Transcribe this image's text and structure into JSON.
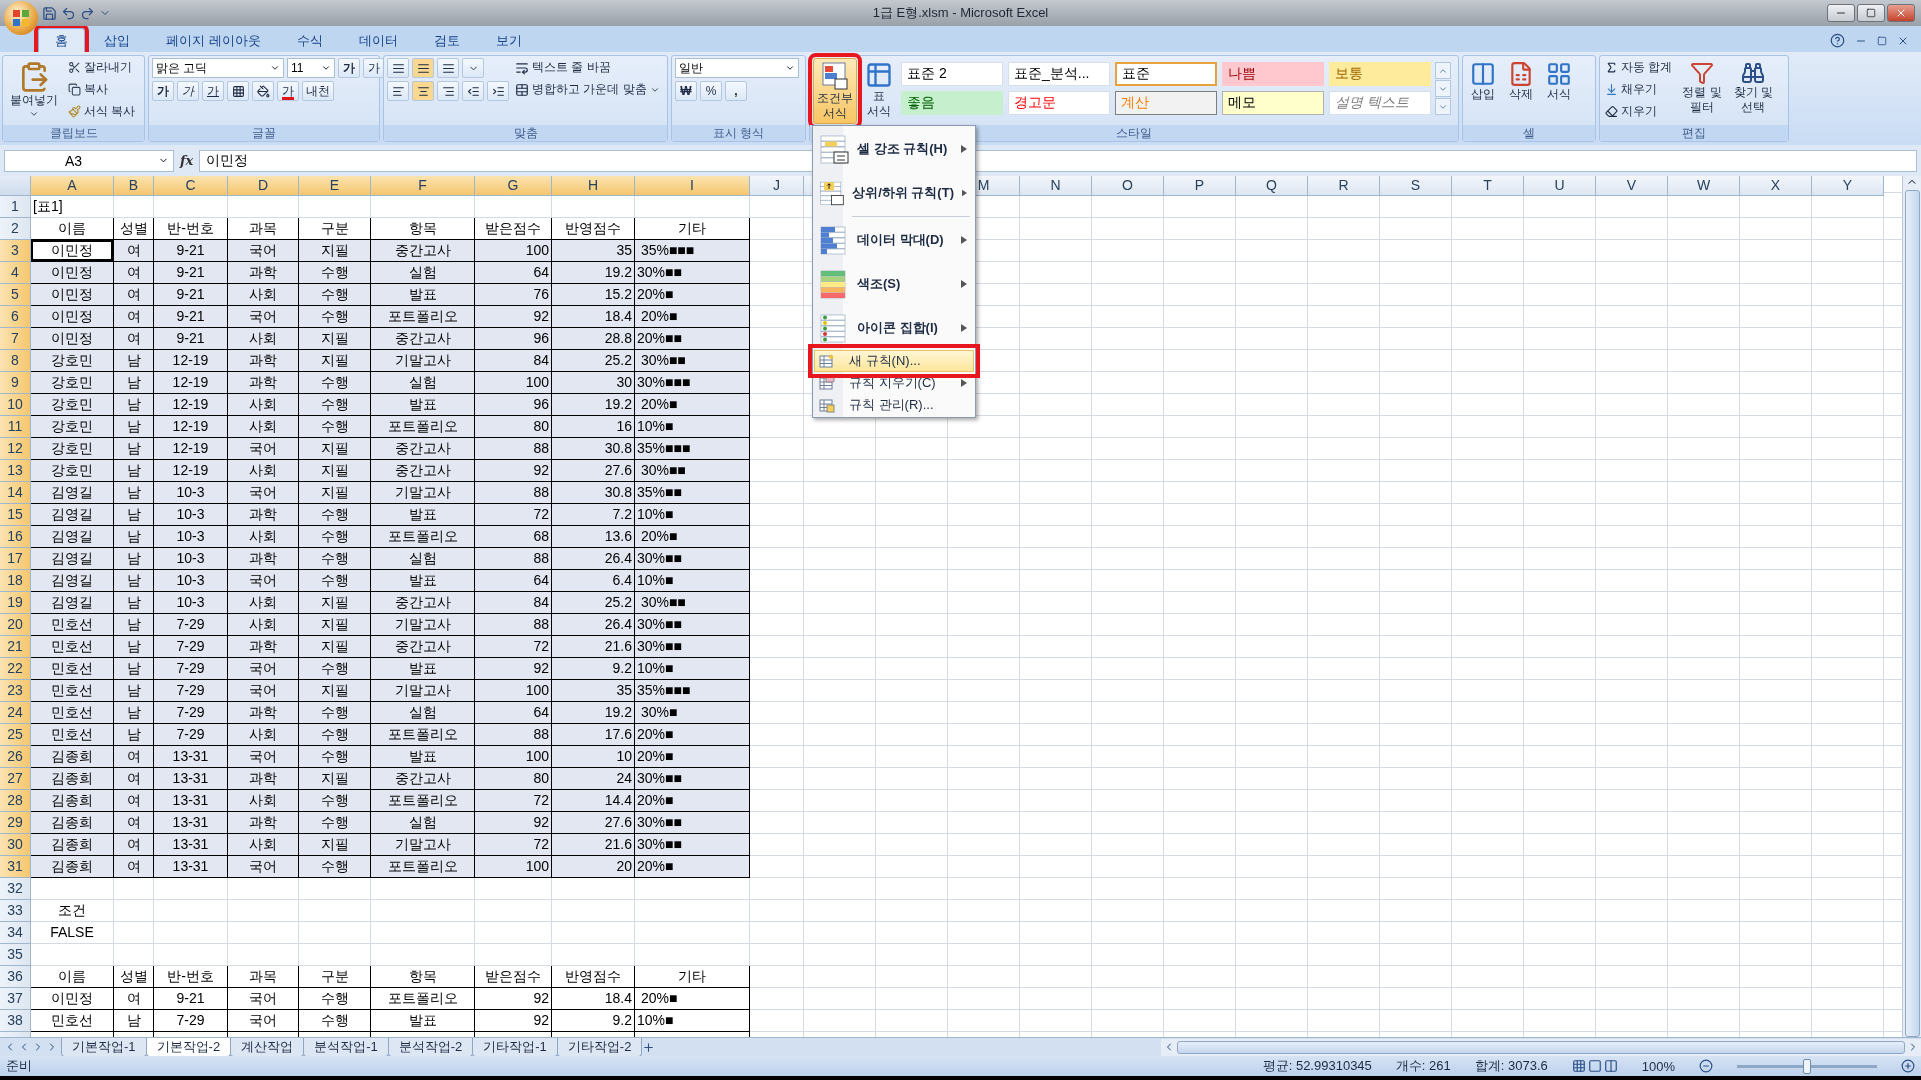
{
  "window": {
    "title": "1급 E형.xlsm - Microsoft Excel"
  },
  "ribbon": {
    "tabs": [
      {
        "label": "홈",
        "selected": true,
        "annotated": true
      },
      {
        "label": "삽입",
        "selected": false
      },
      {
        "label": "페이지 레이아웃",
        "selected": false
      },
      {
        "label": "수식",
        "selected": false
      },
      {
        "label": "데이터",
        "selected": false
      },
      {
        "label": "검토",
        "selected": false
      },
      {
        "label": "보기",
        "selected": false
      }
    ],
    "clipboard": {
      "paste": "붙여넣기",
      "cut": "잘라내기",
      "copy": "복사",
      "format_painter": "서식 복사",
      "label": "클립보드"
    },
    "font": {
      "name": "맑은 고딕",
      "size": "11",
      "grow": "가",
      "shrink": "가",
      "bold": "가",
      "italic": "가",
      "underline": "가",
      "font_color": "가",
      "phonetic": "내천",
      "label": "글꼴"
    },
    "alignment": {
      "wrap": "텍스트 줄 바꿈",
      "merge": "병합하고 가운데 맞춤",
      "label": "맞춤"
    },
    "number": {
      "format": "일반",
      "currency": "₩",
      "percent": "%",
      "comma": ",",
      "label": "표시 형식"
    },
    "styles": {
      "conditional": {
        "lines": [
          "조건부",
          "서식"
        ],
        "annotated": true
      },
      "table_format": {
        "lines": [
          "표",
          "서식"
        ]
      },
      "gallery": [
        {
          "label": "표준 2",
          "kind": "normal",
          "selected": false
        },
        {
          "label": "표준_분석...",
          "kind": "normal",
          "selected": false
        },
        {
          "label": "표준",
          "kind": "normal",
          "selected": true
        },
        {
          "label": "나쁨",
          "kind": "bad",
          "selected": false
        },
        {
          "label": "보통",
          "kind": "neutral",
          "selected": false
        },
        {
          "label": "좋음",
          "kind": "good",
          "selected": false
        },
        {
          "label": "경고문",
          "kind": "warning",
          "selected": false
        },
        {
          "label": "계산",
          "kind": "calc",
          "selected": false
        },
        {
          "label": "메모",
          "kind": "note",
          "selected": false
        },
        {
          "label": "설명 텍스트",
          "kind": "explanatory",
          "selected": false
        }
      ],
      "label": "스타일"
    },
    "cells": {
      "insert": "삽입",
      "delete": "삭제",
      "format": "서식",
      "label": "셀"
    },
    "editing": {
      "autosum": "자동 합계",
      "fill": "채우기",
      "clear": "지우기",
      "sort": [
        "정렬 및",
        "필터"
      ],
      "find": [
        "찾기 및",
        "선택"
      ],
      "label": "편집"
    }
  },
  "formula_bar": {
    "name_box": "A3",
    "function_label": "fx",
    "formula": "이민정"
  },
  "menu": {
    "items": [
      {
        "label": "셀 강조 규칙(H)",
        "kind": "large",
        "submenu": true,
        "selected": false,
        "annotated": false
      },
      {
        "label": "상위/하위 규칙(T)",
        "kind": "large",
        "submenu": true,
        "selected": false,
        "annotated": false
      },
      {
        "label": "데이터 막대(D)",
        "kind": "large",
        "submenu": true,
        "selected": false,
        "annotated": false
      },
      {
        "label": "색조(S)",
        "kind": "large",
        "submenu": true,
        "selected": false,
        "annotated": false
      },
      {
        "label": "아이콘 집합(I)",
        "kind": "large",
        "submenu": true,
        "selected": false,
        "annotated": false
      },
      {
        "label": "새 규칙(N)...",
        "kind": "small",
        "submenu": false,
        "selected": true,
        "annotated": true
      },
      {
        "label": "규칙 지우기(C)",
        "kind": "small",
        "submenu": true,
        "selected": false,
        "annotated": false
      },
      {
        "label": "규칙 관리(R)...",
        "kind": "small",
        "submenu": false,
        "selected": false,
        "annotated": false
      }
    ]
  },
  "columns": [
    {
      "label": "A",
      "selected": true
    },
    {
      "label": "B",
      "selected": true
    },
    {
      "label": "C",
      "selected": true
    },
    {
      "label": "D",
      "selected": true
    },
    {
      "label": "E",
      "selected": true
    },
    {
      "label": "F",
      "selected": true
    },
    {
      "label": "G",
      "selected": true
    },
    {
      "label": "H",
      "selected": true
    },
    {
      "label": "I",
      "selected": true
    },
    {
      "label": "J",
      "selected": false
    },
    {
      "label": "M",
      "selected": false
    },
    {
      "label": "N",
      "selected": false
    },
    {
      "label": "O",
      "selected": false
    },
    {
      "label": "P",
      "selected": false
    },
    {
      "label": "Q",
      "selected": false
    },
    {
      "label": "R",
      "selected": false
    },
    {
      "label": "S",
      "selected": false
    },
    {
      "label": "T",
      "selected": false
    },
    {
      "label": "U",
      "selected": false
    },
    {
      "label": "V",
      "selected": false
    },
    {
      "label": "W",
      "selected": false
    },
    {
      "label": "X",
      "selected": false
    },
    {
      "label": "Y",
      "selected": false
    }
  ],
  "rows": [
    {
      "number": "1",
      "kind": "title",
      "selected": false,
      "cells": [
        "[표1]"
      ]
    },
    {
      "number": "2",
      "kind": "header",
      "selected": false,
      "cells": [
        "이름",
        "성별",
        "반-번호",
        "과목",
        "구분",
        "항목",
        "받은점수",
        "반영점수",
        "기타"
      ]
    },
    {
      "number": "3",
      "kind": "data",
      "selected": true,
      "active": true,
      "cells": [
        "이민정",
        "여",
        "9-21",
        "국어",
        "지필",
        "중간고사",
        "100",
        "35",
        " 35%■■■"
      ]
    },
    {
      "number": "4",
      "kind": "data",
      "selected": true,
      "cells": [
        "이민정",
        "여",
        "9-21",
        "과학",
        "수행",
        "실험",
        "64",
        "19.2",
        "30%■■"
      ]
    },
    {
      "number": "5",
      "kind": "data",
      "selected": true,
      "cells": [
        "이민정",
        "여",
        "9-21",
        "사회",
        "수행",
        "발표",
        "76",
        "15.2",
        "20%■"
      ]
    },
    {
      "number": "6",
      "kind": "data",
      "selected": true,
      "cells": [
        "이민정",
        "여",
        "9-21",
        "국어",
        "수행",
        "포트폴리오",
        "92",
        "18.4",
        " 20%■"
      ]
    },
    {
      "number": "7",
      "kind": "data",
      "selected": true,
      "cells": [
        "이민정",
        "여",
        "9-21",
        "사회",
        "지필",
        "중간고사",
        "96",
        "28.8",
        "20%■■"
      ]
    },
    {
      "number": "8",
      "kind": "data",
      "selected": true,
      "cells": [
        "강호민",
        "남",
        "12-19",
        "과학",
        "지필",
        "기말고사",
        "84",
        "25.2",
        " 30%■■"
      ]
    },
    {
      "number": "9",
      "kind": "data",
      "selected": true,
      "cells": [
        "강호민",
        "남",
        "12-19",
        "과학",
        "수행",
        "실험",
        "100",
        "30",
        "30%■■■"
      ]
    },
    {
      "number": "10",
      "kind": "data",
      "selected": true,
      "cells": [
        "강호민",
        "남",
        "12-19",
        "사회",
        "수행",
        "발표",
        "96",
        "19.2",
        " 20%■"
      ]
    },
    {
      "number": "11",
      "kind": "data",
      "selected": true,
      "cells": [
        "강호민",
        "남",
        "12-19",
        "사회",
        "수행",
        "포트폴리오",
        "80",
        "16",
        "10%■"
      ]
    },
    {
      "number": "12",
      "kind": "data",
      "selected": true,
      "cells": [
        "강호민",
        "남",
        "12-19",
        "국어",
        "지필",
        "중간고사",
        "88",
        "30.8",
        "35%■■■"
      ]
    },
    {
      "number": "13",
      "kind": "data",
      "selected": true,
      "cells": [
        "강호민",
        "남",
        "12-19",
        "사회",
        "지필",
        "중간고사",
        "92",
        "27.6",
        " 30%■■"
      ]
    },
    {
      "number": "14",
      "kind": "data",
      "selected": true,
      "cells": [
        "김영길",
        "남",
        "10-3",
        "국어",
        "지필",
        "기말고사",
        "88",
        "30.8",
        "35%■■"
      ]
    },
    {
      "number": "15",
      "kind": "data",
      "selected": true,
      "cells": [
        "김영길",
        "남",
        "10-3",
        "과학",
        "수행",
        "발표",
        "72",
        "7.2",
        "10%■"
      ]
    },
    {
      "number": "16",
      "kind": "data",
      "selected": true,
      "cells": [
        "김영길",
        "남",
        "10-3",
        "사회",
        "수행",
        "포트폴리오",
        "68",
        "13.6",
        " 20%■"
      ]
    },
    {
      "number": "17",
      "kind": "data",
      "selected": true,
      "cells": [
        "김영길",
        "남",
        "10-3",
        "과학",
        "수행",
        "실험",
        "88",
        "26.4",
        "30%■■"
      ]
    },
    {
      "number": "18",
      "kind": "data",
      "selected": true,
      "cells": [
        "김영길",
        "남",
        "10-3",
        "국어",
        "수행",
        "발표",
        "64",
        "6.4",
        "10%■"
      ]
    },
    {
      "number": "19",
      "kind": "data",
      "selected": true,
      "cells": [
        "김영길",
        "남",
        "10-3",
        "사회",
        "지필",
        "중간고사",
        "84",
        "25.2",
        " 30%■■"
      ]
    },
    {
      "number": "20",
      "kind": "data",
      "selected": true,
      "cells": [
        "민호선",
        "남",
        "7-29",
        "사회",
        "지필",
        "기말고사",
        "88",
        "26.4",
        "30%■■"
      ]
    },
    {
      "number": "21",
      "kind": "data",
      "selected": true,
      "cells": [
        "민호선",
        "남",
        "7-29",
        "과학",
        "지필",
        "중간고사",
        "72",
        "21.6",
        "30%■■"
      ]
    },
    {
      "number": "22",
      "kind": "data",
      "selected": true,
      "cells": [
        "민호선",
        "남",
        "7-29",
        "국어",
        "수행",
        "발표",
        "92",
        "9.2",
        "10%■"
      ]
    },
    {
      "number": "23",
      "kind": "data",
      "selected": true,
      "cells": [
        "민호선",
        "남",
        "7-29",
        "국어",
        "지필",
        "기말고사",
        "100",
        "35",
        "35%■■■"
      ]
    },
    {
      "number": "24",
      "kind": "data",
      "selected": true,
      "cells": [
        "민호선",
        "남",
        "7-29",
        "과학",
        "수행",
        "실험",
        "64",
        "19.2",
        " 30%■"
      ]
    },
    {
      "number": "25",
      "kind": "data",
      "selected": true,
      "cells": [
        "민호선",
        "남",
        "7-29",
        "사회",
        "수행",
        "포트폴리오",
        "88",
        "17.6",
        "20%■"
      ]
    },
    {
      "number": "26",
      "kind": "data",
      "selected": true,
      "cells": [
        "김종희",
        "여",
        "13-31",
        "국어",
        "수행",
        "발표",
        "100",
        "10",
        "20%■"
      ]
    },
    {
      "number": "27",
      "kind": "data",
      "selected": true,
      "cells": [
        "김종희",
        "여",
        "13-31",
        "과학",
        "지필",
        "중간고사",
        "80",
        "24",
        "30%■■"
      ]
    },
    {
      "number": "28",
      "kind": "data",
      "selected": true,
      "cells": [
        "김종희",
        "여",
        "13-31",
        "사회",
        "수행",
        "포트폴리오",
        "72",
        "14.4",
        "20%■"
      ]
    },
    {
      "number": "29",
      "kind": "data",
      "selected": true,
      "cells": [
        "김종희",
        "여",
        "13-31",
        "과학",
        "수행",
        "실험",
        "92",
        "27.6",
        "30%■■"
      ]
    },
    {
      "number": "30",
      "kind": "data",
      "selected": true,
      "cells": [
        "김종희",
        "여",
        "13-31",
        "사회",
        "지필",
        "기말고사",
        "72",
        "21.6",
        "30%■■"
      ]
    },
    {
      "number": "31",
      "kind": "data",
      "selected": true,
      "cells": [
        "김종희",
        "여",
        "13-31",
        "국어",
        "수행",
        "포트폴리오",
        "100",
        "20",
        "20%■"
      ]
    },
    {
      "number": "32",
      "kind": "plain",
      "selected": false,
      "cells": []
    },
    {
      "number": "33",
      "kind": "plain",
      "selected": false,
      "cells": [
        "조건"
      ]
    },
    {
      "number": "34",
      "kind": "plain",
      "selected": false,
      "cells": [
        "FALSE"
      ]
    },
    {
      "number": "35",
      "kind": "plain",
      "selected": false,
      "cells": []
    },
    {
      "number": "36",
      "kind": "header",
      "selected": false,
      "cells": [
        "이름",
        "성별",
        "반-번호",
        "과목",
        "구분",
        "항목",
        "받은점수",
        "반영점수",
        "기타"
      ]
    },
    {
      "number": "37",
      "kind": "data",
      "selected": false,
      "cells": [
        "이민정",
        "여",
        "9-21",
        "국어",
        "수행",
        "포트폴리오",
        "92",
        "18.4",
        " 20%■"
      ]
    },
    {
      "number": "38",
      "kind": "data",
      "selected": false,
      "cells": [
        "민호선",
        "남",
        "7-29",
        "국어",
        "수행",
        "발표",
        "92",
        "9.2",
        "10%■"
      ]
    }
  ],
  "sheet_tabs": [
    {
      "label": "기본작업-1",
      "selected": false
    },
    {
      "label": "기본작업-2",
      "selected": true
    },
    {
      "label": "계산작업",
      "selected": false
    },
    {
      "label": "분석작업-1",
      "selected": false
    },
    {
      "label": "분석작업-2",
      "selected": false
    },
    {
      "label": "기타작업-1",
      "selected": false
    },
    {
      "label": "기타작업-2",
      "selected": false
    }
  ],
  "status_bar": {
    "mode": "준비",
    "average": "평균: 52.99310345",
    "count": "개수: 261",
    "sum": "합계: 3073.6",
    "zoom": "100%",
    "zoom_slider": {
      "level": 0.5
    }
  }
}
